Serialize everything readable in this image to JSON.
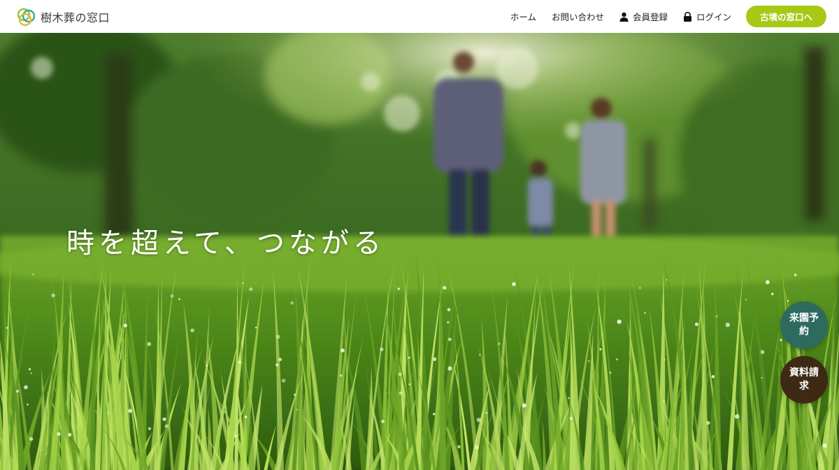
{
  "header": {
    "logo_text": "樹木葬の窓口",
    "logo_icon": "interlocking-circles-logo",
    "nav": {
      "home": "ホーム",
      "contact": "お問い合わせ",
      "register": "会員登録",
      "login": "ログイン"
    },
    "cta_label": "古墳の窓口へ"
  },
  "hero": {
    "heading": "時を超えて、つながる"
  },
  "floating": {
    "visit_label": "来園予約",
    "docs_label": "資料請求"
  },
  "colors": {
    "cta": "#a8c816",
    "visit_button": "#2d6b5e",
    "docs_button": "#3e2a14",
    "grass": "#5f9a1e",
    "logo_green": "#8cc63e",
    "logo_teal": "#3aa6a0",
    "logo_yellow": "#e3b83a"
  }
}
